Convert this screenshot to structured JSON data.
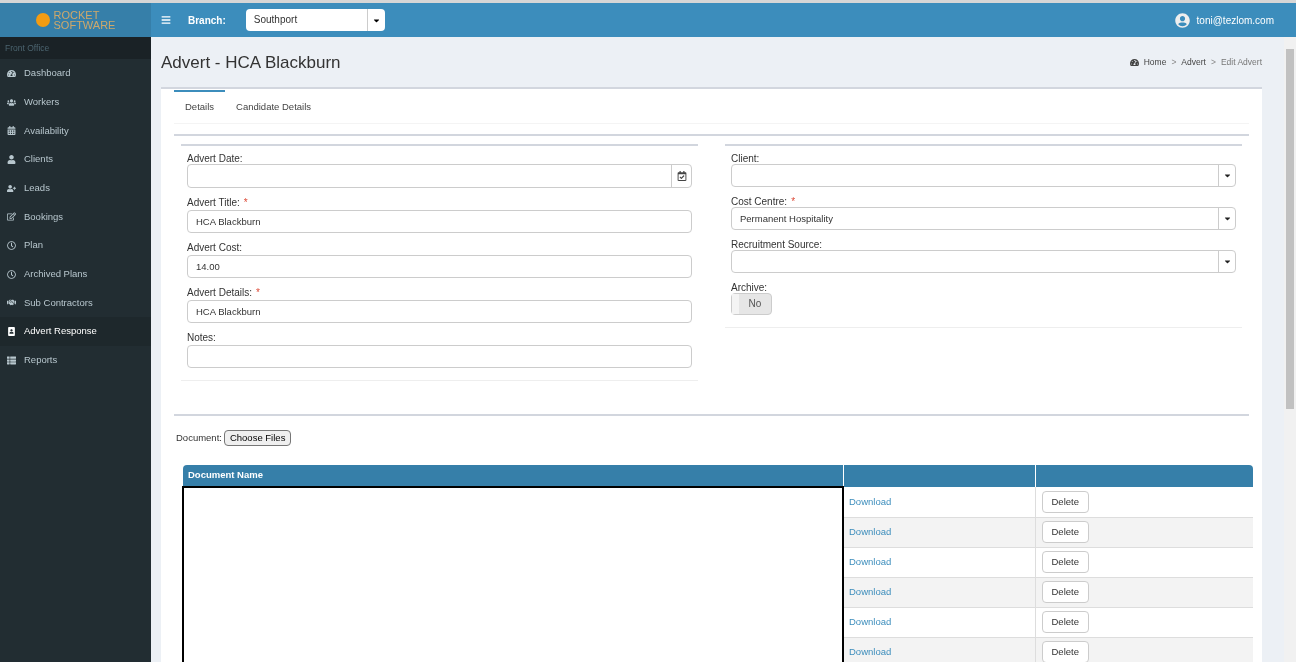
{
  "logo": {
    "line_1": "ROCKET",
    "line_2": "SOFTWARE"
  },
  "topbar": {
    "branch_label": "Branch:",
    "branch_value": "Southport",
    "user": "toni@tezlom.com"
  },
  "sidebar": {
    "header": "Front Office",
    "items": [
      {
        "label": "Dashboard",
        "selected": false
      },
      {
        "label": "Workers",
        "selected": false
      },
      {
        "label": "Availability",
        "selected": false
      },
      {
        "label": "Clients",
        "selected": false
      },
      {
        "label": "Leads",
        "selected": false
      },
      {
        "label": "Bookings",
        "selected": false
      },
      {
        "label": "Plan",
        "selected": false
      },
      {
        "label": "Archived Plans",
        "selected": false
      },
      {
        "label": "Sub Contractors",
        "selected": false
      },
      {
        "label": "Advert Response",
        "selected": true
      },
      {
        "label": "Reports",
        "selected": false
      }
    ]
  },
  "page_title": "Advert - HCA Blackburn",
  "breadcrumb": [
    {
      "label": "Home"
    },
    {
      "separator": ">",
      "label": "Advert"
    },
    {
      "separator": ">",
      "label": "Edit Advert"
    }
  ],
  "tabs": [
    {
      "label": "Details",
      "selected": true
    },
    {
      "label": "Candidate Details",
      "selected": false
    }
  ],
  "left_fields": [
    {
      "label": "Advert Date:",
      "kind": "date"
    },
    {
      "label": "Advert Title:",
      "required_mark": "*",
      "value": "HCA Blackburn",
      "kind": "text"
    },
    {
      "label": "Advert Cost:",
      "value": "14.00",
      "kind": "text"
    },
    {
      "label": "Advert Details:",
      "required_mark": "*",
      "value": "HCA Blackburn",
      "kind": "text"
    },
    {
      "label": "Notes:",
      "kind": "text"
    }
  ],
  "right_fields": [
    {
      "label": "Client:",
      "kind": "select"
    },
    {
      "label": "Cost Centre:",
      "required_mark": "*",
      "value": "Permanent Hospitality",
      "kind": "select"
    },
    {
      "label": "Recruitment Source:",
      "kind": "select"
    },
    {
      "label": "Archive:",
      "value": "No",
      "kind": "toggle",
      "on": false
    }
  ],
  "document": {
    "label": "Document:",
    "button": "Choose Files"
  },
  "table": {
    "columns": [
      "Document Name"
    ],
    "rows": [
      {
        "download": "Download",
        "delete": "Delete"
      },
      {
        "download": "Download",
        "delete": "Delete"
      },
      {
        "download": "Download",
        "delete": "Delete"
      },
      {
        "download": "Download",
        "delete": "Delete"
      },
      {
        "download": "Download",
        "delete": "Delete"
      },
      {
        "download": "Download",
        "delete": "Delete"
      }
    ]
  }
}
